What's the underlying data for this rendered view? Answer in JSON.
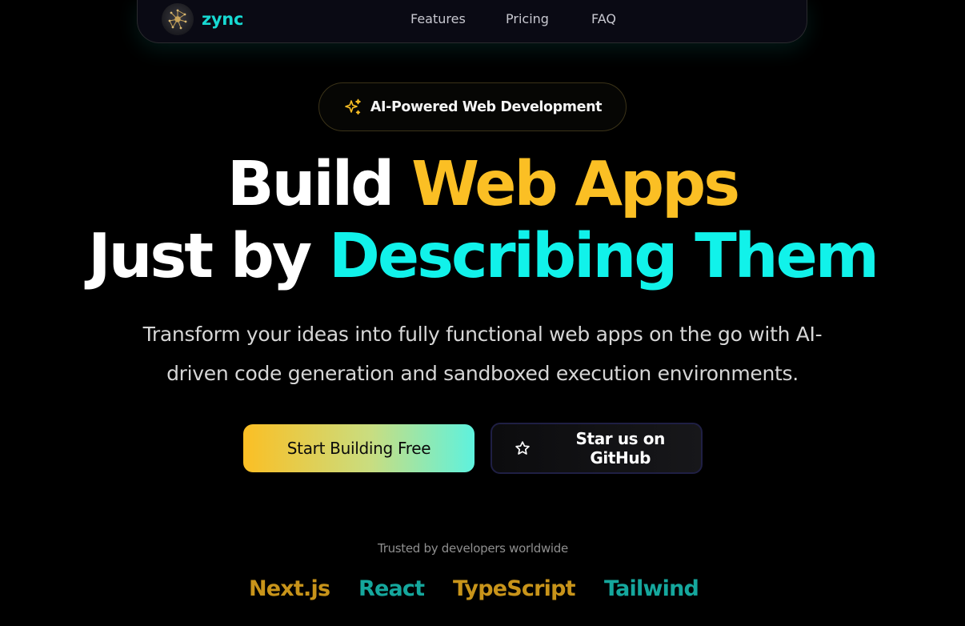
{
  "nav": {
    "brand": "zync",
    "links": [
      "Features",
      "Pricing",
      "FAQ"
    ]
  },
  "badge": {
    "icon": "sparkles-icon",
    "text": "AI-Powered Web Development"
  },
  "headline": {
    "line1_part1": "Build ",
    "line1_part2": "Web Apps",
    "line2_part1": "Just by ",
    "line2_part2": "Describing Them"
  },
  "subtitle": {
    "line1": "Transform your ideas into fully functional web apps on the go with AI-",
    "line2": "driven code generation and sandboxed execution environments."
  },
  "cta": {
    "primary": "Start Building Free",
    "secondary": "Star us on GitHub",
    "secondary_icon": "star-icon"
  },
  "trusted": {
    "label": "Trusted by developers worldwide",
    "items": [
      "Next.js",
      "React",
      "TypeScript",
      "Tailwind"
    ]
  },
  "colors": {
    "background": "#000000",
    "accent_yellow": "#fbbf24",
    "accent_cyan": "#11f2ea",
    "brand_teal": "#17d9d2"
  }
}
